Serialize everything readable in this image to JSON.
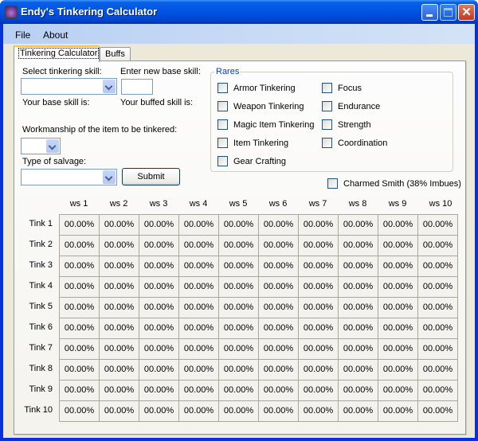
{
  "window": {
    "title": "Endy's Tinkering Calculator",
    "icon": "app-pouch-icon",
    "controls": {
      "minimize": "_",
      "maximize": "□",
      "close": "✕"
    }
  },
  "menu": [
    "File",
    "About"
  ],
  "tabs": [
    {
      "label": "Tinkering Calculator",
      "active": true
    },
    {
      "label": "Buffs",
      "active": false
    }
  ],
  "form": {
    "select_skill_label": "Select tinkering skill:",
    "select_skill_value": "",
    "new_base_label": "Enter new base skill:",
    "new_base_value": "",
    "base_skill_label": "Your base skill is:",
    "buffed_skill_label": "Your buffed skill is:",
    "workmanship_label": "Workmanship of the item to be tinkered:",
    "workmanship_value": "",
    "salvage_label": "Type of salvage:",
    "salvage_value": "",
    "submit_label": "Submit"
  },
  "rares": {
    "title": "Rares",
    "left": [
      {
        "label": "Armor Tinkering",
        "checked": false
      },
      {
        "label": "Weapon Tinkering",
        "checked": false
      },
      {
        "label": "Magic Item Tinkering",
        "checked": false
      },
      {
        "label": "Item Tinkering",
        "checked": false
      },
      {
        "label": "Gear Crafting",
        "checked": false
      }
    ],
    "right": [
      {
        "label": "Focus",
        "checked": false
      },
      {
        "label": "Endurance",
        "checked": false
      },
      {
        "label": "Strength",
        "checked": false
      },
      {
        "label": "Coordination",
        "checked": false
      }
    ]
  },
  "charmed_smith": {
    "label": "Charmed Smith (38% Imbues)",
    "checked": false
  },
  "grid": {
    "columns": [
      "ws 1",
      "ws 2",
      "ws 3",
      "ws 4",
      "ws 5",
      "ws 6",
      "ws 7",
      "ws 8",
      "ws 9",
      "ws 10"
    ],
    "rows": [
      "Tink 1",
      "Tink 2",
      "Tink 3",
      "Tink 4",
      "Tink 5",
      "Tink 6",
      "Tink 7",
      "Tink 8",
      "Tink 9",
      "Tink 10"
    ],
    "values": [
      [
        "00.00%",
        "00.00%",
        "00.00%",
        "00.00%",
        "00.00%",
        "00.00%",
        "00.00%",
        "00.00%",
        "00.00%",
        "00.00%"
      ],
      [
        "00.00%",
        "00.00%",
        "00.00%",
        "00.00%",
        "00.00%",
        "00.00%",
        "00.00%",
        "00.00%",
        "00.00%",
        "00.00%"
      ],
      [
        "00.00%",
        "00.00%",
        "00.00%",
        "00.00%",
        "00.00%",
        "00.00%",
        "00.00%",
        "00.00%",
        "00.00%",
        "00.00%"
      ],
      [
        "00.00%",
        "00.00%",
        "00.00%",
        "00.00%",
        "00.00%",
        "00.00%",
        "00.00%",
        "00.00%",
        "00.00%",
        "00.00%"
      ],
      [
        "00.00%",
        "00.00%",
        "00.00%",
        "00.00%",
        "00.00%",
        "00.00%",
        "00.00%",
        "00.00%",
        "00.00%",
        "00.00%"
      ],
      [
        "00.00%",
        "00.00%",
        "00.00%",
        "00.00%",
        "00.00%",
        "00.00%",
        "00.00%",
        "00.00%",
        "00.00%",
        "00.00%"
      ],
      [
        "00.00%",
        "00.00%",
        "00.00%",
        "00.00%",
        "00.00%",
        "00.00%",
        "00.00%",
        "00.00%",
        "00.00%",
        "00.00%"
      ],
      [
        "00.00%",
        "00.00%",
        "00.00%",
        "00.00%",
        "00.00%",
        "00.00%",
        "00.00%",
        "00.00%",
        "00.00%",
        "00.00%"
      ],
      [
        "00.00%",
        "00.00%",
        "00.00%",
        "00.00%",
        "00.00%",
        "00.00%",
        "00.00%",
        "00.00%",
        "00.00%",
        "00.00%"
      ],
      [
        "00.00%",
        "00.00%",
        "00.00%",
        "00.00%",
        "00.00%",
        "00.00%",
        "00.00%",
        "00.00%",
        "00.00%",
        "00.00%"
      ]
    ]
  }
}
